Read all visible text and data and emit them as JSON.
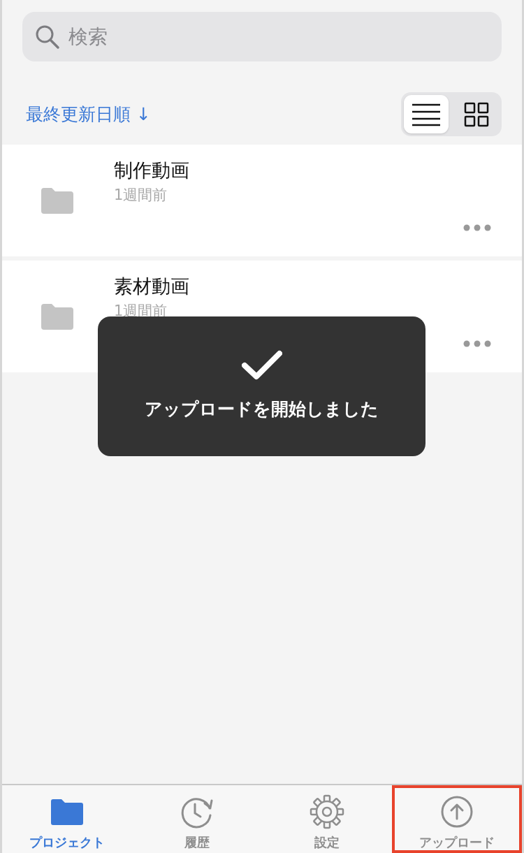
{
  "search": {
    "placeholder": "検索"
  },
  "sort": {
    "label": "最終更新日順 ↓"
  },
  "view_toggle": [
    {
      "kind": "list",
      "selected": true
    },
    {
      "kind": "grid",
      "selected": false
    }
  ],
  "folders": [
    {
      "name": "制作動画",
      "updated": "1週間前"
    },
    {
      "name": "素材動画",
      "updated": "1週間前"
    }
  ],
  "toast": {
    "message": "アップロードを開始しました"
  },
  "tab_bar": [
    {
      "kind": "folder",
      "label": "プロジェクト",
      "selected": true,
      "highlighted": false
    },
    {
      "kind": "history",
      "label": "履歴",
      "selected": false,
      "highlighted": false
    },
    {
      "kind": "settings",
      "label": "設定",
      "selected": false,
      "highlighted": false
    },
    {
      "kind": "upload",
      "label": "アップロード",
      "selected": false,
      "highlighted": true
    }
  ]
}
